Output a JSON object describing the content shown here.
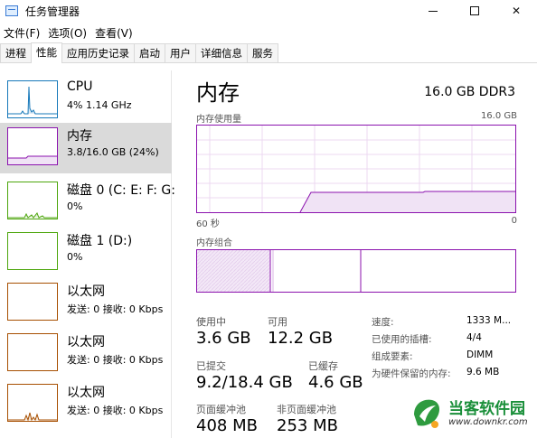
{
  "window": {
    "title": "任务管理器",
    "close_glyph": "✕"
  },
  "menu": [
    {
      "label": "文件(F)"
    },
    {
      "label": "选项(O)"
    },
    {
      "label": "查看(V)"
    }
  ],
  "tabs": [
    {
      "label": "进程",
      "active": false
    },
    {
      "label": "性能",
      "active": true
    },
    {
      "label": "应用历史记录",
      "active": false
    },
    {
      "label": "启动",
      "active": false
    },
    {
      "label": "用户",
      "active": false
    },
    {
      "label": "详细信息",
      "active": false
    },
    {
      "label": "服务",
      "active": false
    }
  ],
  "sidebar": {
    "items": [
      {
        "title": "CPU",
        "subtitle": "4% 1.14 GHz",
        "color": "#1779ba"
      },
      {
        "title": "内存",
        "subtitle": "3.8/16.0 GB (24%)",
        "color": "#8b12ae",
        "selected": true
      },
      {
        "title": "磁盘 0 (C: E: F: G:",
        "subtitle": "0%",
        "color": "#4da60c"
      },
      {
        "title": "磁盘 1 (D:)",
        "subtitle": "0%",
        "color": "#4da60c"
      },
      {
        "title": "以太网",
        "subtitle": "发送: 0 接收: 0 Kbps",
        "color": "#a74f01"
      },
      {
        "title": "以太网",
        "subtitle": "发送: 0 接收: 0 Kbps",
        "color": "#a74f01"
      },
      {
        "title": "以太网",
        "subtitle": "发送: 0 接收: 0 Kbps",
        "color": "#a74f01"
      }
    ]
  },
  "memory": {
    "title": "内存",
    "spec": "16.0 GB DDR3",
    "usage_label": "内存使用量",
    "usage_max": "16.0 GB",
    "time_left": "60 秒",
    "time_right": "0",
    "composition_label": "内存组合",
    "accent_color": "#8b12ae",
    "stats": {
      "in_use": {
        "label": "使用中",
        "value": "3.6 GB"
      },
      "available": {
        "label": "可用",
        "value": "12.2 GB"
      },
      "committed": {
        "label": "已提交",
        "value": "9.2/18.4 GB"
      },
      "cached": {
        "label": "已缓存",
        "value": "4.6 GB"
      },
      "paged_pool": {
        "label": "页面缓冲池",
        "value": "408 MB"
      },
      "nonpaged_pool": {
        "label": "非页面缓冲池",
        "value": "253 MB"
      }
    },
    "info": [
      {
        "label": "速度:",
        "value": "1333 M..."
      },
      {
        "label": "已使用的插槽:",
        "value": "4/4"
      },
      {
        "label": "组成要素:",
        "value": "DIMM"
      },
      {
        "label": "为硬件保留的内存:",
        "value": "9.6 MB"
      }
    ]
  },
  "watermark": {
    "text": "当客软件园",
    "url": "www.downkr.com"
  }
}
